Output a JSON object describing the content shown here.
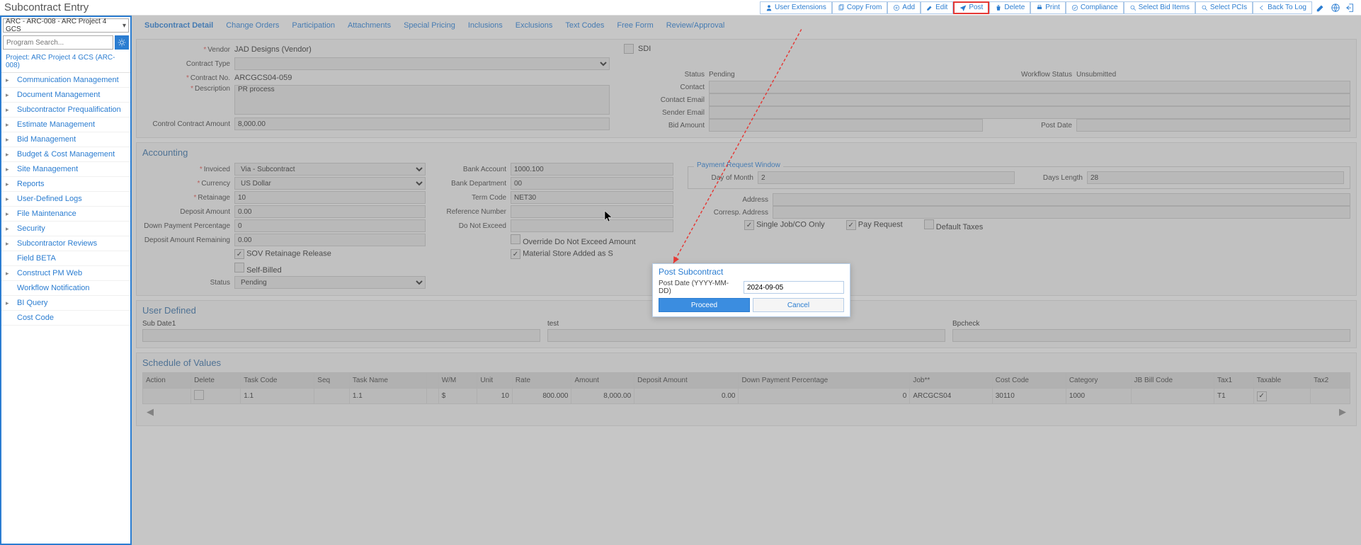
{
  "header": {
    "title": "Subcontract Entry",
    "buttons": {
      "user_ext": "User Extensions",
      "copy_from": "Copy From",
      "add": "Add",
      "edit": "Edit",
      "post": "Post",
      "delete": "Delete",
      "print": "Print",
      "compliance": "Compliance",
      "select_bid": "Select Bid Items",
      "select_pcis": "Select PCIs",
      "back_to_log": "Back To Log"
    }
  },
  "sidebar": {
    "project_select": "ARC - ARC-008 - ARC Project 4 GCS",
    "search_placeholder": "Program Search...",
    "project_label": "Project: ARC Project 4 GCS (ARC-008)",
    "items": [
      {
        "label": "Communication Management",
        "caret": true
      },
      {
        "label": "Document Management",
        "caret": true
      },
      {
        "label": "Subcontractor Prequalification",
        "caret": true
      },
      {
        "label": "Estimate Management",
        "caret": true
      },
      {
        "label": "Bid Management",
        "caret": true
      },
      {
        "label": "Budget & Cost Management",
        "caret": true
      },
      {
        "label": "Site Management",
        "caret": true
      },
      {
        "label": "Reports",
        "caret": true
      },
      {
        "label": "User-Defined Logs",
        "caret": true
      },
      {
        "label": "File Maintenance",
        "caret": true
      },
      {
        "label": "Security",
        "caret": true
      },
      {
        "label": "Subcontractor Reviews",
        "caret": true
      },
      {
        "label": "Field BETA",
        "caret": false
      },
      {
        "label": "Construct PM Web",
        "caret": true
      },
      {
        "label": "Workflow Notification",
        "caret": false
      },
      {
        "label": "BI Query",
        "caret": true
      },
      {
        "label": "Cost Code",
        "caret": false
      }
    ]
  },
  "tabs": [
    "Subcontract Detail",
    "Change Orders",
    "Participation",
    "Attachments",
    "Special Pricing",
    "Inclusions",
    "Exclusions",
    "Text Codes",
    "Free Form",
    "Review/Approval"
  ],
  "detail": {
    "vendor_lbl": "Vendor",
    "vendor": "JAD Designs (Vendor)",
    "contract_type_lbl": "Contract Type",
    "contract_type": "",
    "contract_no_lbl": "Contract No.",
    "contract_no": "ARCGCS04-059",
    "description_lbl": "Description",
    "description": "PR process",
    "control_lbl": "Control Contract Amount",
    "control": "8,000.00",
    "sdi_lbl": "SDI",
    "status_lbl": "Status",
    "status": "Pending",
    "wf_status_lbl": "Workflow Status",
    "wf_status": "Unsubmitted",
    "contact_lbl": "Contact",
    "contact": "",
    "contact_email_lbl": "Contact Email",
    "contact_email": "",
    "sender_email_lbl": "Sender Email",
    "sender_email": "",
    "bid_amount_lbl": "Bid Amount",
    "bid_amount": "",
    "post_date_lbl": "Post Date",
    "post_date": ""
  },
  "accounting": {
    "title": "Accounting",
    "invoiced_lbl": "Invoiced",
    "invoiced": "Via - Subcontract",
    "currency_lbl": "Currency",
    "currency": "US Dollar",
    "retainage_lbl": "Retainage",
    "retainage": "10",
    "deposit_amt_lbl": "Deposit Amount",
    "deposit_amt": "0.00",
    "down_pct_lbl": "Down Payment Percentage",
    "down_pct": "0",
    "deposit_rem_lbl": "Deposit Amount Remaining",
    "deposit_rem": "0.00",
    "sov_rel_lbl": "SOV Retainage Release",
    "self_billed_lbl": "Self-Billed",
    "status_lbl": "Status",
    "status": "Pending",
    "bank_acct_lbl": "Bank Account",
    "bank_acct": "1000.100",
    "bank_dept_lbl": "Bank Department",
    "bank_dept": "00",
    "term_code_lbl": "Term Code",
    "term_code": "NET30",
    "ref_no_lbl": "Reference Number",
    "ref_no": "",
    "dne_lbl": "Do Not Exceed",
    "dne": "",
    "override_lbl": "Override Do Not Exceed Amount",
    "mat_store_lbl": "Material Store Added as S",
    "prw_title": "Payment Request Window",
    "day_month_lbl": "Day of Month",
    "day_month": "2",
    "days_len_lbl": "Days Length",
    "days_len": "28",
    "address_lbl": "Address",
    "address": "",
    "corr_addr_lbl": "Corresp. Address",
    "corr_addr": "",
    "single_job_lbl": "Single Job/CO Only",
    "pay_req_lbl": "Pay Request",
    "def_tax_lbl": "Default Taxes"
  },
  "user_defined": {
    "title": "User Defined",
    "f1_lbl": "Sub Date1",
    "f1": "",
    "f2_lbl": "test",
    "f2": "",
    "f3_lbl": "Bpcheck",
    "f3": ""
  },
  "sov": {
    "title": "Schedule of Values",
    "headers": [
      "Action",
      "Delete",
      "Task Code",
      "Seq",
      "Task Name",
      "",
      "W/M",
      "Unit",
      "Rate",
      "Amount",
      "Deposit Amount",
      "Down Payment Percentage",
      "Job**",
      "Cost Code",
      "Category",
      "JB Bill Code",
      "Tax1",
      "Taxable",
      "Tax2"
    ],
    "row": {
      "task_code": "1.1",
      "seq": "",
      "task_name": "1.1",
      "wm": "$",
      "unit": "10",
      "rate": "800.000",
      "amount": "8,000.00",
      "deposit": "0.00",
      "down_pct": "0",
      "job": "ARCGCS04",
      "cost_code": "30110",
      "category": "1000",
      "jb": "",
      "tax1": "T1",
      "taxable": true,
      "tax2": ""
    }
  },
  "modal": {
    "title": "Post Subcontract",
    "date_lbl": "Post Date (YYYY-MM-DD)",
    "date": "2024-09-05",
    "proceed": "Proceed",
    "cancel": "Cancel"
  }
}
